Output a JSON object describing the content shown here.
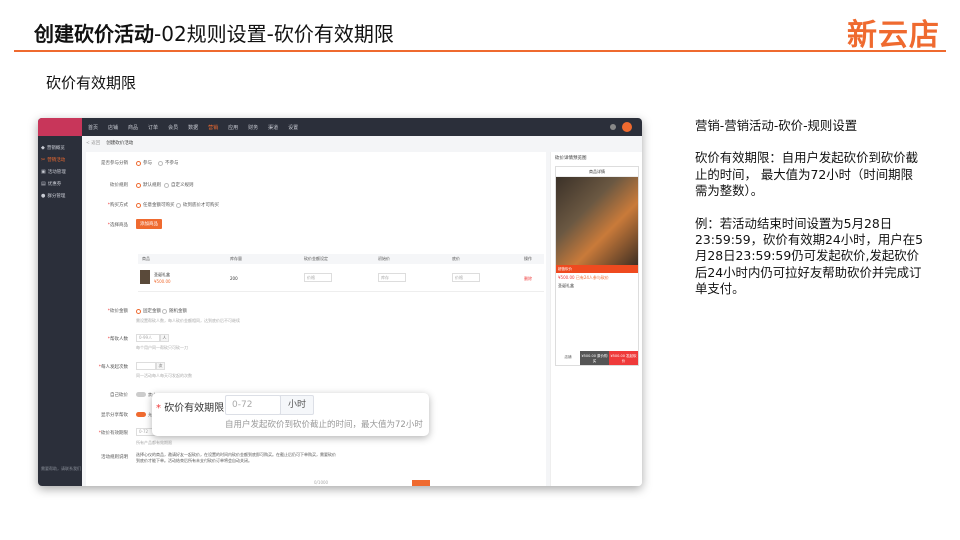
{
  "slide": {
    "title_bold": "创建砍价活动",
    "title_rest": "-02规则设置-砍价有效期限",
    "brand": "新云店",
    "section_title": "砍价有效期限"
  },
  "screenshot": {
    "top_nav": [
      "首页",
      "店铺",
      "商品",
      "订单",
      "会员",
      "数据",
      "营销",
      "应用",
      "财务",
      "渠道",
      "设置"
    ],
    "top_nav_active_index": 6,
    "sidebar_items": [
      {
        "icon": "tag-icon",
        "label": "营销概览"
      },
      {
        "icon": "bargain-icon",
        "label": "营销活动",
        "active": true
      },
      {
        "icon": "gift-icon",
        "label": "活动管理"
      },
      {
        "icon": "coupon-icon",
        "label": "优惠券"
      },
      {
        "icon": "user-icon",
        "label": "群分管理"
      }
    ],
    "sidebar_footer": "需要帮助，请联系我们",
    "breadcrumb": {
      "back": "< 返回",
      "current": "创建砍价活动"
    },
    "form": {
      "rows": [
        {
          "label": "是否参与分销",
          "options": [
            "参与",
            "不参与"
          ]
        },
        {
          "label": "砍价规则",
          "options": [
            "默认规则",
            "自定义规则"
          ]
        },
        {
          "label": "购买方式",
          "options": [
            "任意金额可购买",
            "砍到底价才可购买"
          ]
        }
      ],
      "select_goods_label": "选择商品",
      "add_goods_button": "添加商品",
      "table_headers": [
        "商品",
        "库存量",
        "砍价金额设定",
        "初始价",
        "底价",
        "操作"
      ],
      "table_row": {
        "name": "圣诞礼盒",
        "price": "¥500.00",
        "stock": "200",
        "input1": "价格",
        "input2": "库存",
        "input3": "价格",
        "action": "删除"
      },
      "cut_amount_label": "砍价金额",
      "cut_amount_options": [
        "固定金额",
        "随机金额"
      ],
      "cut_amount_help": "需设置帮砍人数，每人砍价金额相同，达到底价后不可继续",
      "helpers_label": "帮砍人数",
      "helpers_placeholder": "0-99人",
      "helpers_unit": "人",
      "helpers_help": "每个用户同一帮砍只可砍一刀",
      "daily_label": "每人发起次数",
      "daily_unit": "次",
      "daily_help": "同一活动每人每天可发起的次数",
      "self_cut_label": "自己砍价",
      "self_cut_value": "禁止",
      "show_rule_label": "显示分享帮砍",
      "show_rule_value": "允许",
      "validity_label": "砍价有效期限",
      "validity_placeholder": "0-72",
      "validity_help": "所有产品都有效期限",
      "desc_label": "活动规则说明",
      "desc_text": "选择心仪的商品，邀请好友一起砍价，在设置的时间内砍价金额到底即可购买。在截止后仍可下单购买，需要砍价到底价才能下单。活动结束后所有未支付砍价订单将会自动关闭。",
      "desc_count": "0/1000"
    },
    "preview": {
      "title": "砍价详情预览图",
      "phone_header": "商品详情",
      "banner": "超值砍价",
      "price": "¥500.00",
      "price_tag": "已有24人参与砍价",
      "goods_name": "圣诞礼盒",
      "bar_left": "店铺",
      "bar_mid": "¥500.00 原价购买",
      "bar_right": "¥500.00 发起砍价"
    }
  },
  "callout": {
    "label": "砍价有效期限",
    "placeholder": "0-72",
    "unit": "小时",
    "help": "自用户发起砍价到砍价截止的时间，最大值为72小时"
  },
  "notes": {
    "path": "营销-营销活动-砍价-规则设置",
    "desc": "砍价有效期限：自用户发起砍价到砍价截止的时间， 最大值为72小时（时间期限需为整数）。",
    "example": "例：若活动结束时间设置为5月28日23:59:59，砍价有效期24小时，用户在5月28日23:59:59仍可发起砍价,发起砍价后24小时内仍可拉好友帮助砍价并完成订单支付。"
  },
  "colors": {
    "accent": "#ef6a2f",
    "required": "#ef3a3a",
    "sidebar": "#2b2f3a"
  }
}
